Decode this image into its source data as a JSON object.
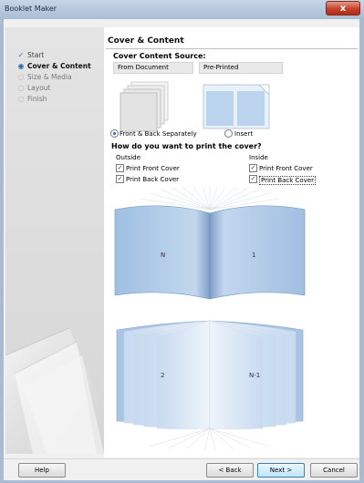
{
  "window": {
    "title": "Booklet Maker",
    "close_glyph": "x"
  },
  "steps": [
    {
      "label": "Start",
      "state": "done"
    },
    {
      "label": "Cover & Content",
      "state": "current"
    },
    {
      "label": "Size & Media",
      "state": "pending"
    },
    {
      "label": "Layout",
      "state": "pending"
    },
    {
      "label": "Finish",
      "state": "pending"
    }
  ],
  "main": {
    "heading": "Cover & Content",
    "source": {
      "label": "Cover Content Source:",
      "options": [
        "From Document",
        "Pre-Printed"
      ],
      "selected": "From Document"
    },
    "mode": {
      "options": [
        "Front & Back Separately",
        "Insert"
      ],
      "selected": "Front & Back Separately"
    },
    "print_question": "How do you want to print the cover?",
    "outside": {
      "label": "Outside",
      "front": {
        "label": "Print Front Cover",
        "checked": true
      },
      "back": {
        "label": "Print Back Cover",
        "checked": true
      }
    },
    "inside": {
      "label": "Inside",
      "front": {
        "label": "Print Front Cover",
        "checked": true
      },
      "back": {
        "label": "Print Back Cover",
        "checked": true
      }
    },
    "preview": {
      "outside_left": "N",
      "outside_right": "1",
      "inside_left": "2",
      "inside_right": "N-1"
    }
  },
  "buttons": {
    "help": "Help",
    "back": "< Back",
    "next": "Next >",
    "cancel": "Cancel"
  },
  "colors": {
    "accent": "#2a5fb4",
    "book_blue": "#8fb4dc"
  }
}
